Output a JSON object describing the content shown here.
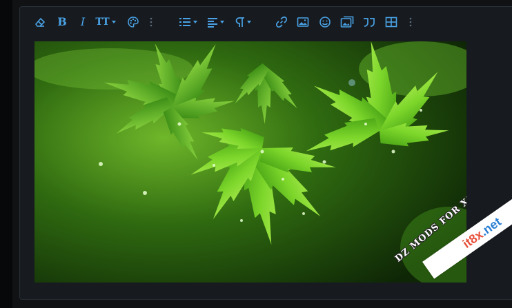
{
  "toolbar": {
    "items": [
      {
        "icon": "eraser-icon",
        "name": "remove-format-button"
      },
      {
        "icon": "bold-icon",
        "label": "B"
      },
      {
        "icon": "italic-icon",
        "label": "I"
      },
      {
        "icon": "text-size-icon",
        "label": "TT"
      },
      {
        "icon": "palette-icon"
      },
      {
        "icon": "more-vertical-icon"
      },
      {
        "icon": "list-icon"
      },
      {
        "icon": "align-icon"
      },
      {
        "icon": "paragraph-icon"
      },
      {
        "icon": "link-icon"
      },
      {
        "icon": "image-icon"
      },
      {
        "icon": "smile-icon"
      },
      {
        "icon": "media-icon"
      },
      {
        "icon": "quote-icon"
      },
      {
        "icon": "table-icon"
      },
      {
        "icon": "more-vertical-icon"
      }
    ],
    "accent": "#4aa3e6"
  },
  "image": {
    "subject": "green maple leaves with water droplets",
    "watermark": "DZ MODS FOR XENFORO"
  },
  "badge": {
    "part1": "it8x",
    "part2": ".net"
  }
}
